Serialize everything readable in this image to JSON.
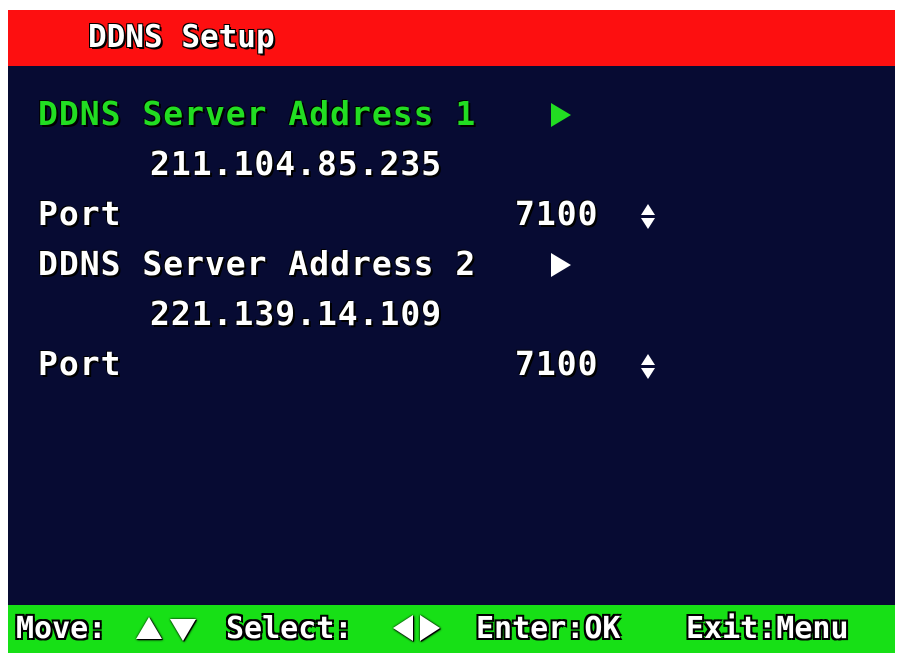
{
  "title": "DDNS Setup",
  "colors": {
    "title_bar": "#fd0f10",
    "background": "#070b33",
    "help_bar": "#17e016",
    "selected_text": "#22dd22",
    "text": "#ffffff"
  },
  "servers": [
    {
      "label": "DDNS Server Address 1",
      "address": "211.104.85.235",
      "port_label": "Port",
      "port_value": "7100",
      "selected": true
    },
    {
      "label": "DDNS Server Address 2",
      "address": "221.139.14.109",
      "port_label": "Port",
      "port_value": "7100",
      "selected": false
    }
  ],
  "icons": {
    "submenu_arrow": "triangle-right-icon",
    "value_adjust": "up-down-arrows-icon"
  },
  "help": {
    "move_label": "Move:",
    "select_label": "Select:",
    "enter_label": "Enter:OK",
    "exit_label": "Exit:Menu"
  }
}
